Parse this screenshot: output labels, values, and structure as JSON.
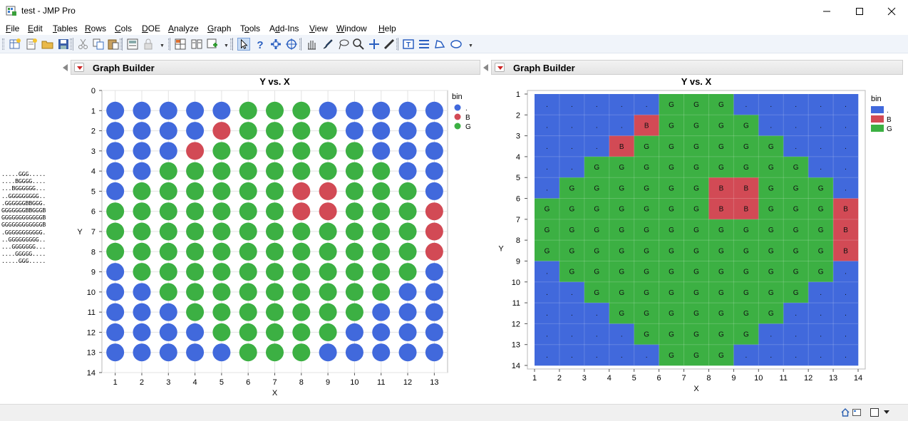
{
  "window": {
    "title": "test - JMP Pro"
  },
  "menu": [
    {
      "label": "File",
      "u": "F"
    },
    {
      "label": "Edit",
      "u": "E"
    },
    {
      "label": "Tables",
      "u": "T"
    },
    {
      "label": "Rows",
      "u": "R"
    },
    {
      "label": "Cols",
      "u": "C"
    },
    {
      "label": "DOE",
      "u": "D"
    },
    {
      "label": "Analyze",
      "u": "A"
    },
    {
      "label": "Graph",
      "u": "G"
    },
    {
      "label": "Tools",
      "u": "o"
    },
    {
      "label": "Add-Ins",
      "u": "d"
    },
    {
      "label": "View",
      "u": "V"
    },
    {
      "label": "Window",
      "u": "W"
    },
    {
      "label": "Help",
      "u": "H"
    }
  ],
  "toolbar_icons": [
    "new-data-table-icon",
    "new-script-icon",
    "open-icon",
    "save-icon",
    "cut-icon",
    "copy-icon",
    "paste-icon",
    "journal-icon",
    "lock-icon",
    "data-grid-icon",
    "subset-icon",
    "add-rows-icon",
    "arrow-tool-icon",
    "help-tool-icon",
    "selection-tool-icon",
    "crosshair-tool-icon",
    "hand-tool-icon",
    "brush-tool-icon",
    "lasso-tool-icon",
    "magnifier-tool-icon",
    "plus-tool-icon",
    "line-tool-icon",
    "annotate-tool-icon",
    "simple-shape-tool-icon",
    "polygon-tool-icon",
    "oval-tool-icon"
  ],
  "bitmap_text": [
    ".....GGG.....",
    "....BGGGG....",
    "...BGGGGGG...",
    "..GGGGGGGGG..",
    ".GGGGGGBBGGG.",
    "GGGGGGGBBGGGB",
    "GGGGGGGGGGGGB",
    "GGGGGGGGGGGGB",
    ".GGGGGGGGGGG.",
    "..GGGGGGGGG..",
    "...GGGGGGG...",
    "....GGGGG....",
    ".....GGG....."
  ],
  "panels": [
    {
      "header": "Graph Builder"
    },
    {
      "header": "Graph Builder"
    }
  ],
  "colors": {
    "dot": "#4169dc",
    "B": "#d24a55",
    "G": "#3cb043",
    "grid": "#e3e3e3"
  },
  "chart_data": [
    {
      "type": "scatter",
      "title": "Y vs. X",
      "xlabel": "X",
      "ylabel": "Y",
      "xlim": [
        0.5,
        13.5
      ],
      "ylim": [
        0,
        14
      ],
      "y_reversed": true,
      "x_ticks": [
        1,
        2,
        3,
        4,
        5,
        6,
        7,
        8,
        9,
        10,
        11,
        12,
        13
      ],
      "y_ticks": [
        0,
        1,
        2,
        3,
        4,
        5,
        6,
        7,
        8,
        9,
        10,
        11,
        12,
        13,
        14
      ],
      "legend": {
        "title": "bin",
        "entries": [
          ".",
          "B",
          "G"
        ],
        "placement": "right"
      },
      "series_source": "bitmap_text",
      "note_y": "row index 1..13"
    },
    {
      "type": "heatmap",
      "title": "Y vs. X",
      "xlabel": "X",
      "ylabel": "Y",
      "xlim": [
        1,
        14
      ],
      "ylim": [
        1,
        14
      ],
      "y_reversed": true,
      "x_ticks": [
        1,
        2,
        3,
        4,
        5,
        6,
        7,
        8,
        9,
        10,
        11,
        12,
        13,
        14
      ],
      "y_ticks": [
        1,
        2,
        3,
        4,
        5,
        6,
        7,
        8,
        9,
        10,
        11,
        12,
        13,
        14
      ],
      "legend": {
        "title": "bin",
        "entries": [
          ".",
          "B",
          "G"
        ],
        "placement": "right"
      },
      "cell_labels": true,
      "series_source": "bitmap_text"
    }
  ]
}
